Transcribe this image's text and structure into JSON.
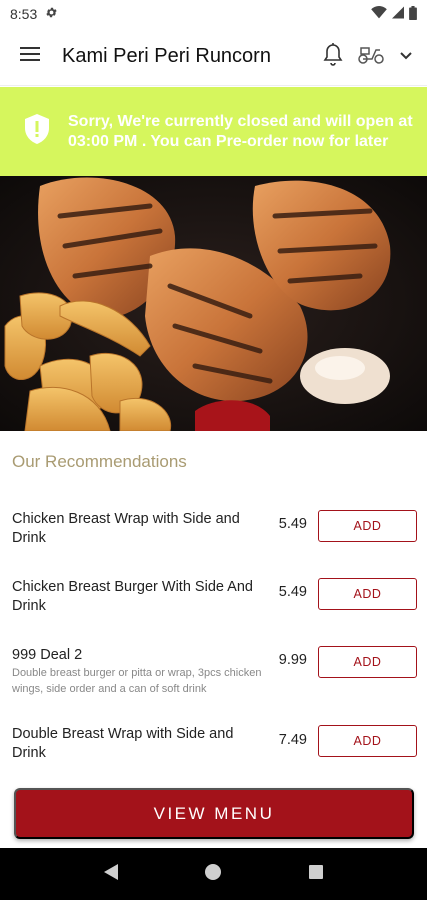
{
  "status_bar": {
    "time": "8:53"
  },
  "app_bar": {
    "title": "Kami Peri Peri Runcorn"
  },
  "banner": {
    "message": "Sorry, We're currently closed and will open at 03:00 PM . You can Pre-order now for later"
  },
  "recommendations": {
    "title": "Our Recommendations",
    "items": [
      {
        "name": "Chicken Breast Wrap with Side and Drink",
        "price": "5.49",
        "add_label": "ADD"
      },
      {
        "name": "Chicken Breast Burger With Side And Drink",
        "price": "5.49",
        "add_label": "ADD"
      },
      {
        "name": "999 Deal 2",
        "description": "Double breast burger or pitta or wrap, 3pcs chicken wings, side order and a can of soft drink",
        "price": "9.99",
        "add_label": "ADD"
      },
      {
        "name": "Double Breast Wrap with Side and Drink",
        "price": "7.49",
        "add_label": "ADD"
      }
    ]
  },
  "view_menu_label": "VIEW MENU",
  "colors": {
    "accent": "#a3121a",
    "banner": "#d6f65d",
    "heading": "#a99b72"
  }
}
